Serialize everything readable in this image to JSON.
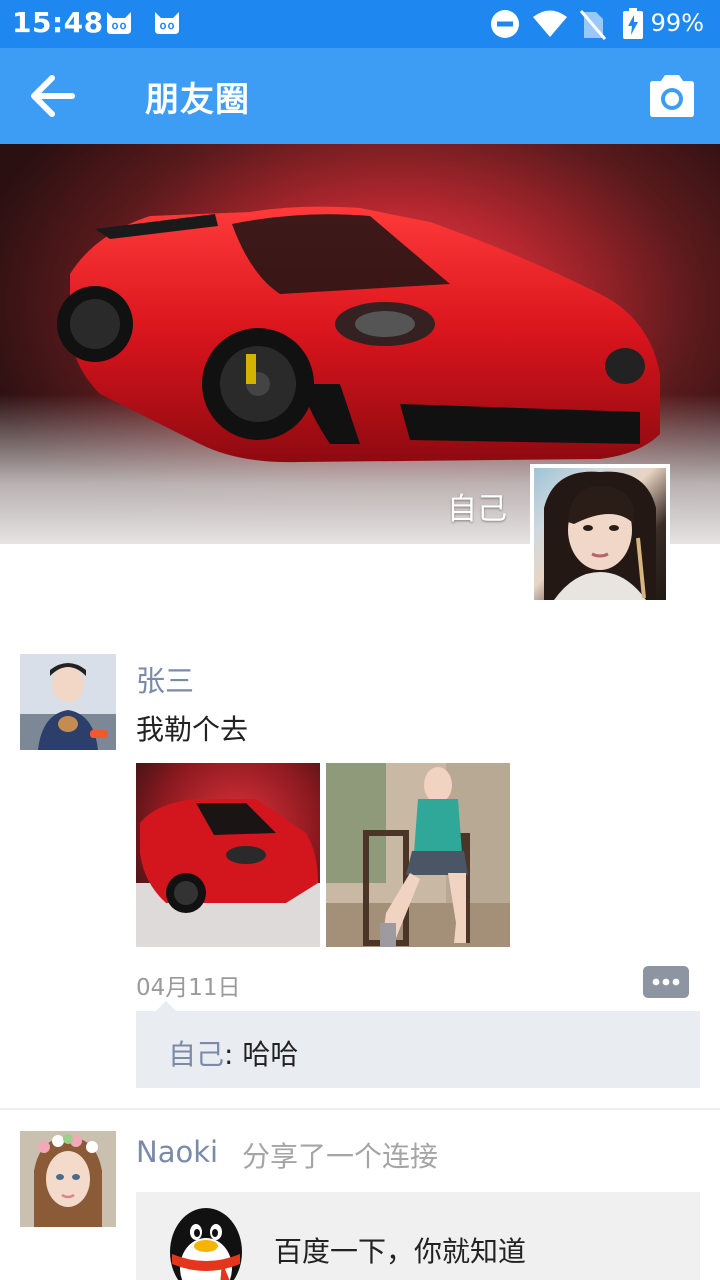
{
  "status_bar": {
    "time": "15:48",
    "battery_pct": "99%",
    "icons": [
      "cat-notification-icon",
      "cat-notification-icon",
      "do-not-disturb-icon",
      "wifi-icon",
      "no-sim-icon",
      "battery-charging-icon"
    ]
  },
  "toolbar": {
    "title": "朋友圈",
    "back_icon": "back-arrow-icon",
    "camera_icon": "camera-icon"
  },
  "cover": {
    "name": "自己"
  },
  "posts": [
    {
      "author": "张三",
      "text": "我勒个去",
      "date": "04月11日",
      "comments": [
        {
          "author": "自己",
          "separator": ": ",
          "text": "哈哈"
        }
      ]
    },
    {
      "author": "Naoki",
      "action": "分享了一个连接",
      "link": {
        "title": "百度一下，你就知道"
      }
    }
  ],
  "colors": {
    "status_bar": "#1e88f0",
    "toolbar": "#3d9df5",
    "name_link": "#7a8aa8",
    "comment_bg": "#e9ecf0"
  }
}
